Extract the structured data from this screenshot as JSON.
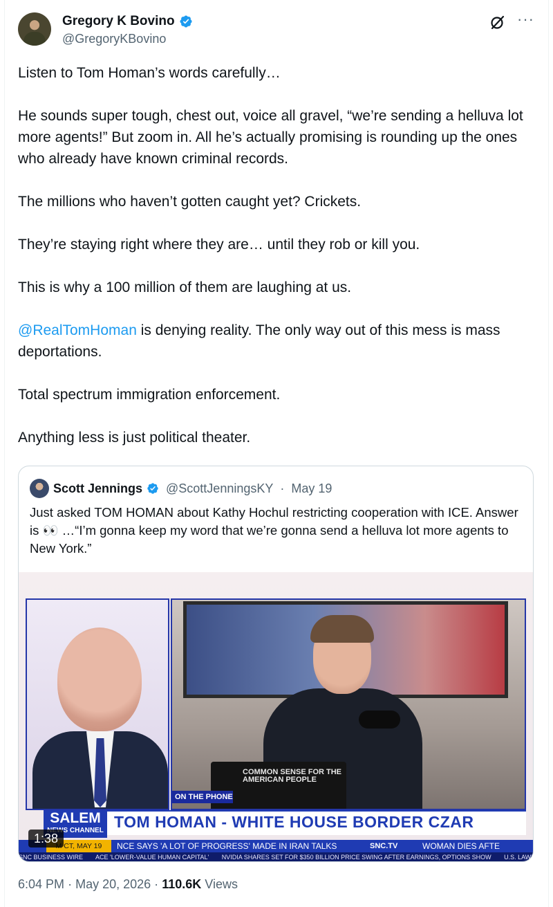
{
  "author": {
    "display_name": "Gregory K Bovino",
    "handle": "@GregoryKBovino",
    "verified": true
  },
  "actions": {
    "grok_icon": "grok-icon",
    "more_icon": "more-icon",
    "more_glyph": "···"
  },
  "tweet": {
    "paragraphs": [
      "Listen to Tom Homan’s words carefully…",
      "He sounds super tough, chest out, voice all gravel, “we’re sending a helluva lot more agents!” But zoom in. All he’s actually promising is rounding up the ones who already have known criminal records.",
      "The millions who haven’t gotten caught yet? Crickets.",
      "They’re staying right where they are… until they rob or kill you.",
      "This is why a 100 million of them are laughing at us."
    ],
    "mention": "@RealTomHoman",
    "mention_rest": " is denying reality.  The only way out of this mess is mass deportations.",
    "paragraphs_after": [
      "Total spectrum immigration enforcement.",
      "Anything less is just political theater."
    ]
  },
  "quote": {
    "display_name": "Scott Jennings",
    "handle": "@ScottJenningsKY",
    "separator": "·",
    "date": "May 19",
    "text": "Just asked TOM HOMAN about Kathy Hochul restricting cooperation with ICE. Answer is 👀 …“I’m gonna keep my word that we’re gonna send a helluva lot more agents to New York.”",
    "video": {
      "duration": "1:38",
      "on_the_phone": "ON THE PHONE",
      "laptop_text": "COMMON SENSE FOR THE AMERICAN PEOPLE",
      "network": "SALEM",
      "network_sub": "NEWS CHANNEL",
      "headline": "TOM HOMAN - WHITE HOUSE BORDER CZAR",
      "ticker_time": "M CT, MAY 19",
      "ticker_1": "NCE SAYS 'A LOT OF PROGRESS' MADE IN IRAN TALKS",
      "ticker_brand": "SNC.TV",
      "ticker_2": "WOMAN DIES AFTE",
      "crawl": [
        "SNC BUSINESS WIRE",
        "ACE 'LOWER-VALUE HUMAN CAPITAL'",
        "NVIDIA SHARES SET FOR $350 BILLION PRICE SWING AFTER EARNINGS, OPTIONS SHOW",
        "U.S. LAWMAKERS SEEK TO UN"
      ]
    }
  },
  "footer": {
    "time": "6:04 PM",
    "dot": "·",
    "date": "May 20, 2026",
    "views_count": "110.6K",
    "views_label": "Views"
  },
  "colors": {
    "text": "#0f1419",
    "secondary": "#536471",
    "link": "#1d9bf0",
    "verified": "#1d9bf0",
    "border": "#cfd9de",
    "salem_blue": "#1f3bb3",
    "ticker_yellow": "#f2b300"
  }
}
